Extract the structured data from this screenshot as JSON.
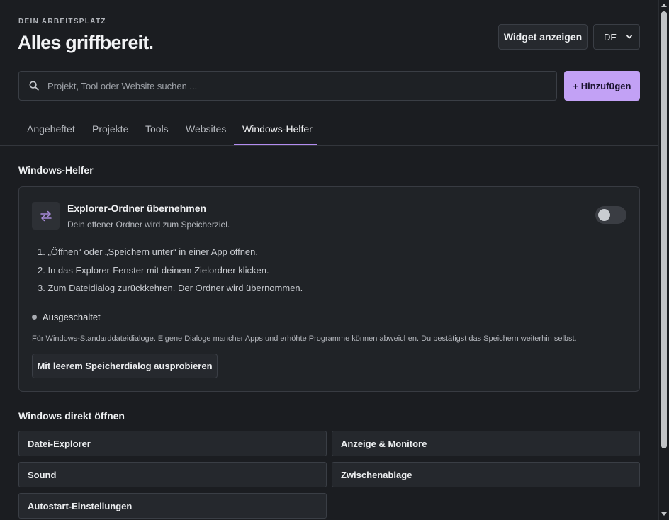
{
  "header": {
    "eyebrow": "DEIN ARBEITSPLATZ",
    "title": "Alles griffbereit.",
    "widget_button": "Widget anzeigen",
    "language": "DE"
  },
  "search": {
    "placeholder": "Projekt, Tool oder Website suchen ...",
    "add_button": "+ Hinzufügen"
  },
  "tabs": [
    {
      "label": "Angeheftet",
      "active": false
    },
    {
      "label": "Projekte",
      "active": false
    },
    {
      "label": "Tools",
      "active": false
    },
    {
      "label": "Websites",
      "active": false
    },
    {
      "label": "Windows-Helfer",
      "active": true
    }
  ],
  "helper_section": {
    "title": "Windows-Helfer",
    "card": {
      "title": "Explorer-Ordner übernehmen",
      "subtitle": "Dein offener Ordner wird zum Speicherziel.",
      "toggle_on": false,
      "steps": [
        "1. „Öffnen“ oder „Speichern unter“ in einer App öffnen.",
        "2. In das Explorer-Fenster mit deinem Zielordner klicken.",
        "3. Zum Dateidialog zurückkehren. Der Ordner wird übernommen."
      ],
      "status": "Ausgeschaltet",
      "note": "Für Windows-Standarddateidialoge. Eigene Dialoge mancher Apps und erhöhte Programme können abweichen. Du bestätigst das Speichern weiterhin selbst.",
      "try_button": "Mit leerem Speicherdialog ausprobieren"
    }
  },
  "windows_section": {
    "title": "Windows direkt öffnen",
    "items": [
      "Datei-Explorer",
      "Anzeige & Monitore",
      "Sound",
      "Zwischenablage",
      "Autostart-Einstellungen"
    ]
  },
  "colors": {
    "background": "#1b1d21",
    "accent": "#c2a1f5",
    "tab_underline": "#b38cf0"
  }
}
